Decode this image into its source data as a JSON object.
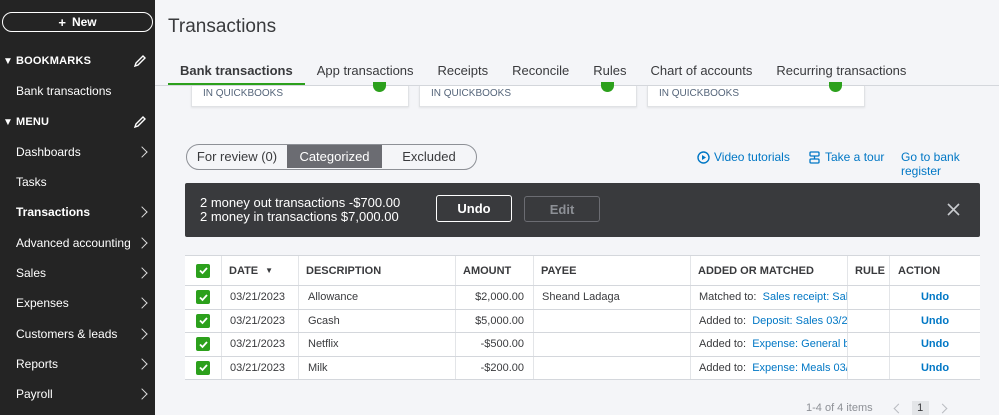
{
  "sidebar": {
    "new_label": "New",
    "bookmarks_label": "BOOKMARKS",
    "bookmark_item": "Bank transactions",
    "menu_label": "MENU",
    "items": [
      {
        "label": "Dashboards"
      },
      {
        "label": "Tasks"
      },
      {
        "label": "Transactions"
      },
      {
        "label": "Advanced accounting"
      },
      {
        "label": "Sales"
      },
      {
        "label": "Expenses"
      },
      {
        "label": "Customers & leads"
      },
      {
        "label": "Reports"
      },
      {
        "label": "Payroll"
      }
    ]
  },
  "header": {
    "title": "Transactions"
  },
  "tabs": [
    "Bank transactions",
    "App transactions",
    "Receipts",
    "Reconcile",
    "Rules",
    "Chart of accounts",
    "Recurring transactions"
  ],
  "cards": [
    "IN QUICKBOOKS",
    "IN QUICKBOOKS",
    "IN QUICKBOOKS"
  ],
  "filter": {
    "for_review": "For review (0)",
    "categorized": "Categorized",
    "excluded": "Excluded"
  },
  "links": {
    "video": "Video tutorials",
    "tour": "Take a tour",
    "register": "Go to bank register"
  },
  "banner": {
    "line1": "2 money out transactions -$700.00",
    "line2": "2 money in transactions $7,000.00",
    "undo": "Undo",
    "edit": "Edit"
  },
  "table": {
    "columns": {
      "date": "DATE",
      "description": "DESCRIPTION",
      "amount": "AMOUNT",
      "payee": "PAYEE",
      "added": "ADDED OR MATCHED",
      "rule": "RULE",
      "action": "ACTION"
    },
    "rows": [
      {
        "date": "03/21/2023",
        "description": "Allowance",
        "amount": "$2,000.00",
        "payee": "Sheand Ladaga",
        "added_prefix": "Matched to:",
        "added_link": "Sales receipt: Sal",
        "action": "Undo"
      },
      {
        "date": "03/21/2023",
        "description": "Gcash",
        "amount": "$5,000.00",
        "payee": "",
        "added_prefix": "Added to:",
        "added_link": "Deposit: Sales 03/2",
        "action": "Undo"
      },
      {
        "date": "03/21/2023",
        "description": "Netflix",
        "amount": "-$500.00",
        "payee": "",
        "added_prefix": "Added to:",
        "added_link": "Expense: General b",
        "action": "Undo"
      },
      {
        "date": "03/21/2023",
        "description": "Milk",
        "amount": "-$200.00",
        "payee": "",
        "added_prefix": "Added to:",
        "added_link": "Expense: Meals 03/",
        "action": "Undo"
      }
    ]
  },
  "pager": {
    "range": "1-4 of 4 items",
    "page": "1"
  },
  "colors": {
    "accent_green": "#2ca01c",
    "link_blue": "#0077c5",
    "sidebar_bg": "#242424",
    "banner_bg": "#393a3d"
  }
}
